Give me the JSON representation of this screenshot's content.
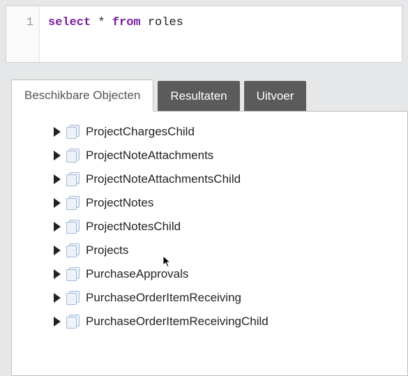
{
  "editor": {
    "lineNumber": "1",
    "kw_select": "select",
    "star": " * ",
    "kw_from": "from",
    "table": " roles"
  },
  "tabs": {
    "t0": "Beschikbare Objecten",
    "t1": "Resultaten",
    "t2": "Uitvoer"
  },
  "tree": {
    "items": {
      "i0": "ProjectChargesChild",
      "i1": "ProjectNoteAttachments",
      "i2": "ProjectNoteAttachmentsChild",
      "i3": "ProjectNotes",
      "i4": "ProjectNotesChild",
      "i5": "Projects",
      "i6": "PurchaseApprovals",
      "i7": "PurchaseOrderItemReceiving",
      "i8": "PurchaseOrderItemReceivingChild"
    }
  }
}
